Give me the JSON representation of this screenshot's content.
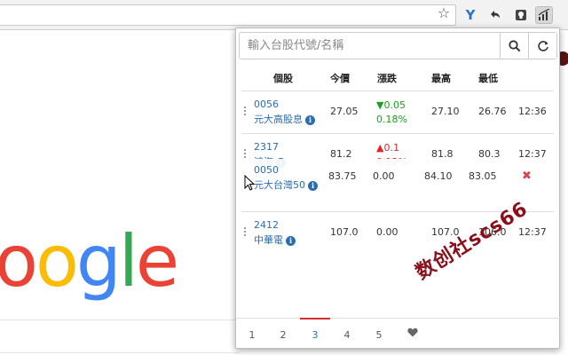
{
  "browser": {
    "ext_icons": [
      "star-icon",
      "y-extension-icon",
      "back-arrow-extension-icon",
      "bulb-extension-icon",
      "stock-chart-extension-icon"
    ]
  },
  "google": {
    "logo_letters": [
      "o",
      "o",
      "g",
      "l",
      "e"
    ]
  },
  "search": {
    "placeholder": "輸入台股代號/名稱"
  },
  "headers": {
    "stock": "個股",
    "price": "今價",
    "change": "漲跌",
    "high": "最高",
    "low": "最低"
  },
  "rows": [
    {
      "code": "0056",
      "name": "元大高股息",
      "price": "27.05",
      "change": "▼0.05",
      "pct": "0.18%",
      "high": "27.10",
      "low": "26.76",
      "time": "12:36",
      "dir": "down"
    },
    {
      "code": "2317",
      "name": "鴻海",
      "price": "81.2",
      "change": "▲0.1",
      "pct": "0.12%",
      "high": "81.8",
      "low": "80.3",
      "time": "12:37",
      "dir": "up"
    },
    {
      "code": "2412",
      "name": "中華電",
      "price": "107.0",
      "change": "0.00",
      "pct": "",
      "high": "107.0",
      "low": "106.0",
      "time": "12:37",
      "dir": "flat"
    }
  ],
  "dragging": {
    "code": "0050",
    "name": "元大台灣50",
    "price": "83.75",
    "change": "0.00",
    "high": "84.10",
    "low": "83.05"
  },
  "pages": [
    "1",
    "2",
    "3",
    "4",
    "5"
  ],
  "active_page": "3",
  "watermark": "数创社scs66",
  "colors": {
    "accent": "#2a6db0",
    "up": "#e0262b",
    "down": "#17a21a",
    "delete": "#d9434b",
    "active_tab_bar": "#d42e2e"
  }
}
